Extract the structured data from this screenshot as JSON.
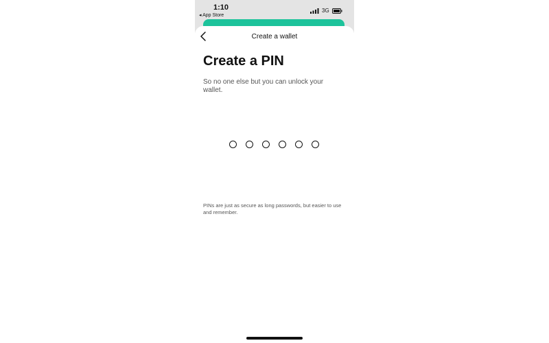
{
  "status_bar": {
    "time": "1:10",
    "back_app": "◂ App Store",
    "network": "3G"
  },
  "nav": {
    "title": "Create a wallet"
  },
  "content": {
    "heading": "Create a PIN",
    "subtitle": "So no one else but you can unlock your wallet.",
    "pin_length": 6,
    "footnote": "PINs are just as secure as long passwords, but easier to use and remember."
  },
  "colors": {
    "accent": "#1dc39b",
    "status_bar_bg": "#e4e4e4"
  }
}
